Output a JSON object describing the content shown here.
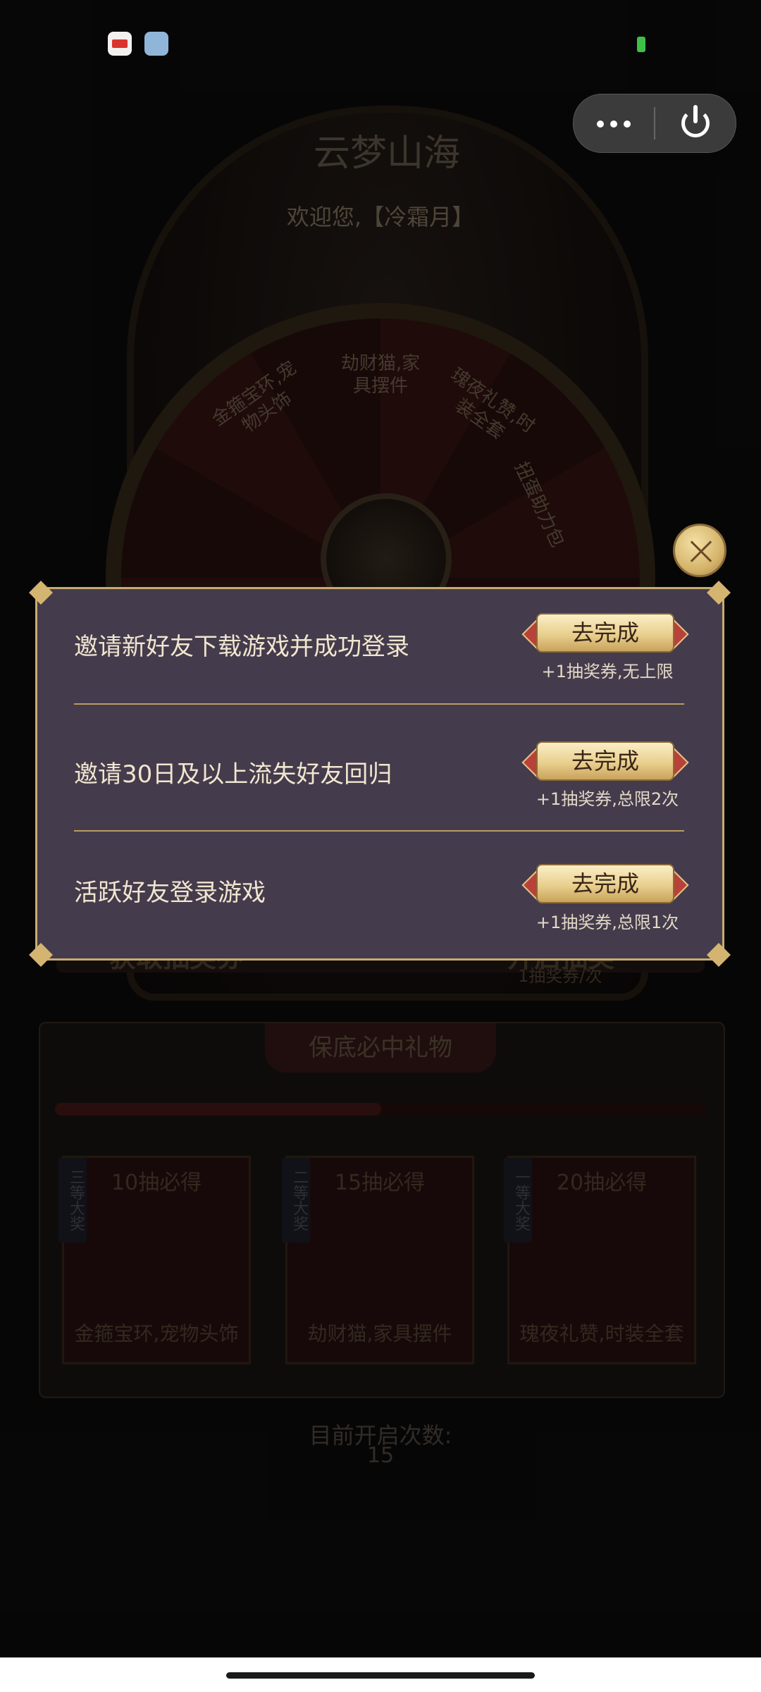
{
  "background": {
    "logo": "云梦山海",
    "welcome": "欢迎您,【冷霜月】",
    "wheel_prizes": [
      "金箍宝环,宠物头饰",
      "劫财猫,家具摆件",
      "瑰夜礼赞,时装全套",
      "扭蛋助力包"
    ],
    "strip_left": "获取抽奖券",
    "strip_right": "开启抽奖",
    "strip_cost": "1抽奖券/次",
    "guarantee_title": "保底必中礼物",
    "progress": 0.5,
    "cards": [
      {
        "tag": "三等大奖",
        "head": "10抽必得",
        "name": "金箍宝环,宠物头饰"
      },
      {
        "tag": "二等大奖",
        "head": "15抽必得",
        "name": "劫财猫,家具摆件"
      },
      {
        "tag": "一等大奖",
        "head": "20抽必得",
        "name": "瑰夜礼赞,时装全套"
      }
    ],
    "count_label": "目前开启次数:",
    "count_value": "15"
  },
  "dialog": {
    "tasks": [
      {
        "text": "邀请新好友下载游戏并成功登录",
        "button": "去完成",
        "reward": "+1抽奖券,无上限"
      },
      {
        "text": "邀请30日及以上流失好友回归",
        "button": "去完成",
        "reward": "+1抽奖券,总限2次"
      },
      {
        "text": "活跃好友登录游戏",
        "button": "去完成",
        "reward": "+1抽奖券,总限1次"
      }
    ]
  },
  "colors": {
    "dialog_bg": "#443c4c",
    "dialog_border": "#c8ac6e",
    "button_gold": "#e9cf8e",
    "battery": "#3ec048"
  },
  "icons": {
    "close": "close-icon",
    "more": "more-dots-icon",
    "power": "power-icon"
  }
}
